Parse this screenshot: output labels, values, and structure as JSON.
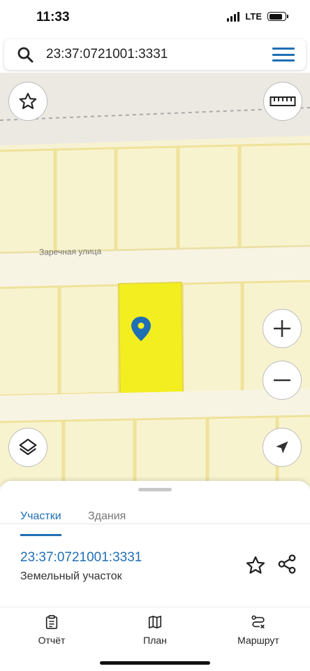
{
  "status_bar": {
    "time": "11:33",
    "network": "LTE"
  },
  "search": {
    "query": "23:37:0721001:3331",
    "icon": "search-icon",
    "menu_icon": "hamburger-menu-icon"
  },
  "map": {
    "street_label": "Заречная улица",
    "highlight_color": "#f3ee20",
    "pin_color": "#1f6fb5",
    "buttons": {
      "favorite": "star-icon",
      "ruler": "ruler-icon",
      "zoom_in": "plus-icon",
      "zoom_out": "minus-icon",
      "layers": "layers-icon",
      "location": "location-arrow-icon"
    }
  },
  "sheet": {
    "tabs": [
      {
        "label": "Участки",
        "active": true
      },
      {
        "label": "Здания",
        "active": false
      }
    ],
    "parcel_number": "23:37:0721001:3331",
    "parcel_type": "Земельный участок"
  },
  "bottom_nav": [
    {
      "label": "Отчёт",
      "icon": "report-icon"
    },
    {
      "label": "План",
      "icon": "map-icon"
    },
    {
      "label": "Маршрут",
      "icon": "route-icon"
    }
  ],
  "colors": {
    "accent": "#1f6fb5",
    "map_background": "#f7f2d4",
    "parcel_border": "#eee08a"
  }
}
